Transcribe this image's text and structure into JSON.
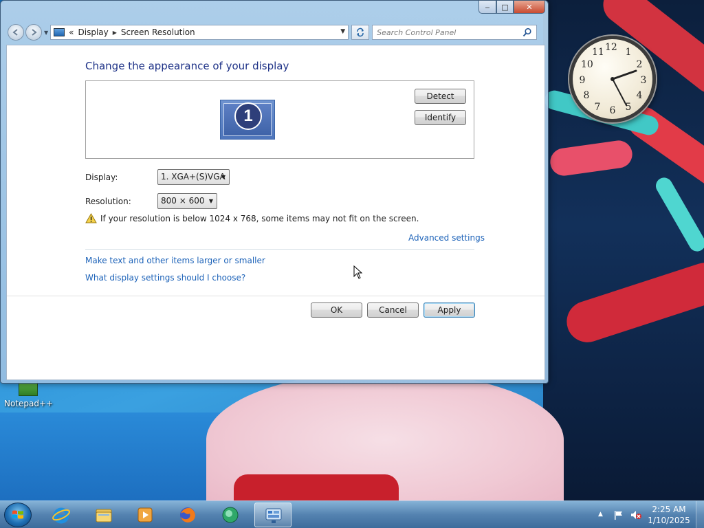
{
  "desktop": {
    "icons": [
      {
        "label": "Notepad++"
      }
    ],
    "gadget": {
      "type": "clock",
      "numerals": [
        "12",
        "1",
        "2",
        "3",
        "4",
        "5",
        "6",
        "7",
        "8",
        "9",
        "10",
        "11"
      ]
    }
  },
  "window": {
    "caption_buttons": {
      "minimize": "‒",
      "maximize": "□",
      "close": "✕"
    },
    "breadcrumb": [
      "Display",
      "Screen Resolution"
    ],
    "breadcrumb_prefix": "«",
    "search": {
      "placeholder": "Search Control Panel"
    },
    "content": {
      "title": "Change the appearance of your display",
      "monitor_number": "1",
      "detect_label": "Detect",
      "identify_label": "Identify",
      "display": {
        "label": "Display:",
        "value": "1. XGA+(S)VGA"
      },
      "resolution": {
        "label": "Resolution:",
        "value": "800 × 600"
      },
      "warning": "If your resolution is below 1024 x 768, some items may not fit on the screen.",
      "advanced_link": "Advanced settings",
      "links": [
        "Make text and other items larger or smaller",
        "What display settings should I choose?"
      ],
      "ok_label": "OK",
      "cancel_label": "Cancel",
      "apply_label": "Apply"
    }
  },
  "taskbar": {
    "apps": [
      "internet-explorer",
      "windows-explorer",
      "media-player",
      "firefox",
      "app",
      "control-panel"
    ],
    "clock": {
      "time": "2:25 AM",
      "date": "1/10/2025"
    },
    "tray_expand": "▲"
  },
  "colors": {
    "title_blue": "#1e3287",
    "link_blue": "#1c62b8",
    "taskbar": "#4678aa"
  }
}
